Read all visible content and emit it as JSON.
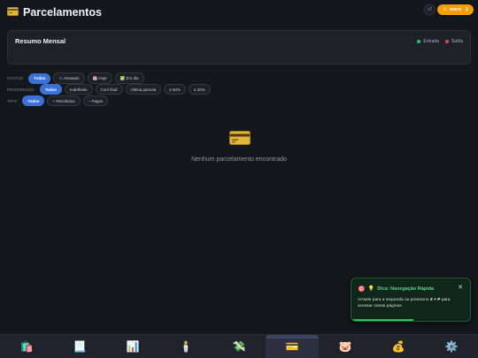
{
  "header": {
    "icon": "credit-card-icon",
    "title": "Parcelamentos",
    "chip_label": "v2",
    "warn_label": "warn",
    "warn_count": "1",
    "warn_color": "#f59e0b"
  },
  "summary": {
    "title": "Resumo Mensal",
    "legend": [
      {
        "label": "Entrada",
        "color": "#22c55e"
      },
      {
        "label": "Saída",
        "color": "#ef4444"
      }
    ]
  },
  "filters": {
    "status": {
      "label": "STATUS",
      "options": [
        "Todos",
        "⚠ Atrasado",
        "📅 Hoje",
        "✅ Em dia"
      ]
    },
    "progresso": {
      "label": "PROGRESSO",
      "options": [
        "Todos",
        "Indefinido",
        "Com final",
        "Última parcela",
        "≥ 50%",
        "≤ 20%"
      ]
    },
    "tipo": {
      "label": "TIPO",
      "options": [
        "Todos",
        "+ Recebidos",
        "− Pagos"
      ]
    },
    "accent": "#3b72d9"
  },
  "empty_state": {
    "icon": "credit-card-icon",
    "text": "Nenhum parcelamento encontrado"
  },
  "tip": {
    "icons": [
      "target-icon",
      "lightbulb-icon"
    ],
    "title": "Dica: Navegação Rápida",
    "body_prefix": "Arraste para a esquerda ou pressione ",
    "shortcut": "Z + P",
    "body_suffix": " para acessar outras páginas.",
    "close": "✕",
    "progress": 0.52
  },
  "bottom_nav": [
    {
      "name": "shopping-bags-icon",
      "glyph": "🛍️",
      "active": false
    },
    {
      "name": "receipt-icon",
      "glyph": "📃",
      "active": false
    },
    {
      "name": "bar-chart-icon",
      "glyph": "📊",
      "active": false
    },
    {
      "name": "candle-icon",
      "glyph": "🕯️",
      "active": false
    },
    {
      "name": "money-with-wings-icon",
      "glyph": "💸",
      "active": false
    },
    {
      "name": "credit-card-icon",
      "glyph": "💳",
      "active": true
    },
    {
      "name": "piggy-bank-icon",
      "glyph": "🐷",
      "active": false
    },
    {
      "name": "money-bag-icon",
      "glyph": "💰",
      "active": false
    },
    {
      "name": "gear-icon",
      "glyph": "⚙️",
      "active": false
    }
  ]
}
